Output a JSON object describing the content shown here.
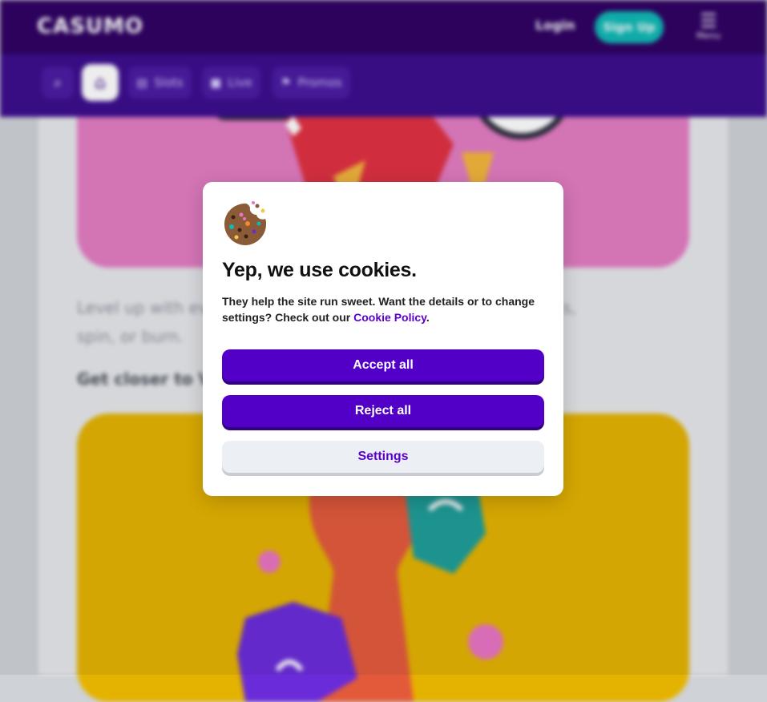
{
  "header": {
    "logo": "CASUMO",
    "login_label": "Login",
    "signup_label": "Sign Up",
    "menu_icon": "hamburger-icon",
    "menu_label": "Menu"
  },
  "nav": {
    "search_icon": "search-icon",
    "home_icon": "home-icon",
    "items": [
      {
        "label": "Slots",
        "icon": "slots-icon"
      },
      {
        "label": "Live",
        "icon": "camera-icon"
      },
      {
        "label": "Promos",
        "icon": "promo-icon"
      }
    ]
  },
  "background": {
    "paragraph_line1": "Level up with eve",
    "paragraph_line1_end": "s,",
    "paragraph_line2": "spin, or burn.",
    "subheading": "Get closer to Valu"
  },
  "cookie_modal": {
    "icon": "cookie-icon",
    "title": "Yep, we use cookies.",
    "text_before": "They help the site run sweet. Want the details or to change settings? Check out our ",
    "link_text": "Cookie Policy",
    "text_after": ".",
    "accept_label": "Accept all",
    "reject_label": "Reject all",
    "settings_label": "Settings"
  },
  "colors": {
    "brand_dark": "#2e0061",
    "brand_purple": "#5200c8",
    "teal": "#0fb8b3",
    "hero_pink": "#e37cc2",
    "hero_yellow": "#e4b200"
  }
}
